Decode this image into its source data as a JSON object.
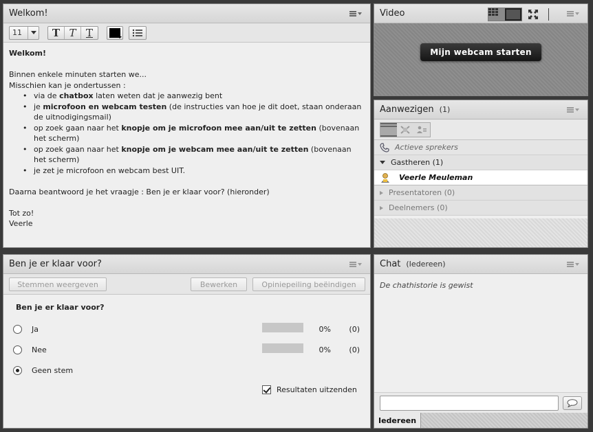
{
  "welkom": {
    "title": "Welkom!",
    "font_size": "11",
    "text_color": "#000000",
    "content": {
      "heading": "Welkom!",
      "line1": "Binnen enkele minuten starten we...",
      "line2": "Misschien kan je ondertussen :",
      "bullets": [
        {
          "pre": "via de ",
          "bold": "chatbox",
          "post": " laten weten dat je aanwezig bent"
        },
        {
          "pre": "je ",
          "bold": "microfoon en webcam testen",
          "post": " (de instructies van hoe je dit doet, staan onderaan de uitnodigingsmail)"
        },
        {
          "pre": "op zoek gaan naar het ",
          "bold": "knopje om je microfoon mee aan/uit te zetten",
          "post": " (bovenaan het scherm)"
        },
        {
          "pre": "op zoek gaan naar het ",
          "bold": "knopje om je webcam mee aan/uit te zetten",
          "post": " (bovenaan het scherm)"
        },
        {
          "pre": "je zet je microfoon en webcam best UIT.",
          "bold": "",
          "post": ""
        }
      ],
      "line3": "Daarna beantwoord je het vraagje : Ben je er klaar voor? (hieronder)",
      "line4": "Tot zo!",
      "line5": "Veerle"
    }
  },
  "video": {
    "title": "Video",
    "start_button": "Mijn webcam starten"
  },
  "attendees": {
    "title": "Aanwezigen",
    "count": "(1)",
    "active_speakers": "Actieve sprekers",
    "hosts": "Gastheren (1)",
    "host_name": "Veerle Meuleman",
    "presenters": "Presentatoren (0)",
    "participants": "Deelnemers (0)"
  },
  "poll": {
    "title": "Ben je er klaar voor?",
    "show_votes": "Stemmen weergeven",
    "edit": "Bewerken",
    "end_poll": "Opiniepeiling beëindigen",
    "question": "Ben je er klaar voor?",
    "options": [
      {
        "label": "Ja",
        "pct": "0%",
        "count": "(0)",
        "selected": false
      },
      {
        "label": "Nee",
        "pct": "0%",
        "count": "(0)",
        "selected": false
      },
      {
        "label": "Geen stem",
        "selected": true
      }
    ],
    "broadcast_results": "Resultaten uitzenden"
  },
  "chat": {
    "title": "Chat",
    "scope": "(Iedereen)",
    "history_cleared": "De chathistorie is gewist",
    "tab": "Iedereen",
    "input_value": ""
  }
}
